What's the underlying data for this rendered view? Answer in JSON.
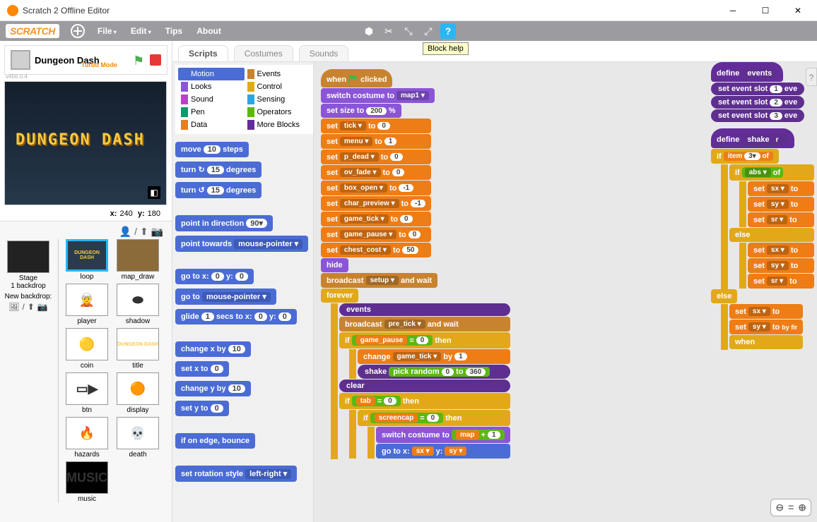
{
  "window": {
    "title": "Scratch 2 Offline Editor"
  },
  "menu": {
    "file": "File",
    "edit": "Edit",
    "tips": "Tips",
    "about": "About"
  },
  "tooltip": "Block help",
  "project": {
    "name": "Dungeon Dash",
    "turbo": "Turbo Mode",
    "version": "v456.0.4"
  },
  "stage": {
    "title_text": "DUNGEON DASH",
    "x_label": "x:",
    "x": "240",
    "y_label": "y:",
    "y": "180"
  },
  "stage_col": {
    "label": "Stage",
    "sub": "1 backdrop",
    "new": "New backdrop:"
  },
  "sprites": [
    {
      "name": "loop",
      "sel": true
    },
    {
      "name": "map_draw"
    },
    {
      "name": "player"
    },
    {
      "name": "shadow"
    },
    {
      "name": "coin"
    },
    {
      "name": "title"
    },
    {
      "name": "btn"
    },
    {
      "name": "display"
    },
    {
      "name": "hazards"
    },
    {
      "name": "death"
    },
    {
      "name": "music"
    }
  ],
  "tabs": {
    "scripts": "Scripts",
    "costumes": "Costumes",
    "sounds": "Sounds"
  },
  "categories": [
    {
      "name": "Motion",
      "color": "#4a6cd4",
      "active": true
    },
    {
      "name": "Events",
      "color": "#c88330"
    },
    {
      "name": "Looks",
      "color": "#8a55d7"
    },
    {
      "name": "Control",
      "color": "#e1a91a"
    },
    {
      "name": "Sound",
      "color": "#bb42c3"
    },
    {
      "name": "Sensing",
      "color": "#2ca5e2"
    },
    {
      "name": "Pen",
      "color": "#0e9a6c"
    },
    {
      "name": "Operators",
      "color": "#5cb712"
    },
    {
      "name": "Data",
      "color": "#ee7d16"
    },
    {
      "name": "More Blocks",
      "color": "#632d99"
    }
  ],
  "palette": {
    "move": "move",
    "move_v": "10",
    "steps": "steps",
    "turn_r": "turn ↻",
    "turn_l": "turn ↺",
    "deg_v": "15",
    "degrees": "degrees",
    "point_dir": "point in direction",
    "dir_v": "90▾",
    "point_tw": "point towards",
    "ptw_v": "mouse-pointer ▾",
    "goto": "go to x:",
    "goto_x": "0",
    "goto_yl": "y:",
    "goto_y": "0",
    "goto_mp": "go to",
    "mp_v": "mouse-pointer ▾",
    "glide": "glide",
    "glide_s": "1",
    "glide_t": "secs to x:",
    "glide_x": "0",
    "glide_y": "0",
    "chx": "change x by",
    "chx_v": "10",
    "setx": "set x to",
    "setx_v": "0",
    "chy": "change y by",
    "chy_v": "10",
    "sety": "set y to",
    "sety_v": "0",
    "edge": "if on edge, bounce",
    "rot": "set rotation style",
    "rot_v": "left-right ▾"
  },
  "script": {
    "when_clicked": "when",
    "clicked": "clicked",
    "switch_costume": "switch costume to",
    "map1": "map1 ▾",
    "set_size": "set size to",
    "size_v": "200",
    "pct": "%",
    "set": "set",
    "to": "to",
    "vars": [
      {
        "n": "tick ▾",
        "v": "0"
      },
      {
        "n": "menu ▾",
        "v": "1"
      },
      {
        "n": "p_dead ▾",
        "v": "0"
      },
      {
        "n": "ov_fade ▾",
        "v": "0"
      },
      {
        "n": "box_open ▾",
        "v": "-1"
      },
      {
        "n": "char_preview ▾",
        "v": "-1"
      },
      {
        "n": "game_tick ▾",
        "v": "0"
      },
      {
        "n": "game_pause ▾",
        "v": "0"
      },
      {
        "n": "chest_cost ▾",
        "v": "50"
      }
    ],
    "hide": "hide",
    "broadcast": "broadcast",
    "setup": "setup ▾",
    "and_wait": "and wait",
    "forever": "forever",
    "events_call": "events",
    "pre_tick": "pre_tick ▾",
    "if": "if",
    "gp_var": "game_pause",
    "eq": "=",
    "zero": "0",
    "then": "then",
    "change": "change",
    "gt_var": "game_tick ▾",
    "by": "by",
    "one": "1",
    "shake": "shake",
    "pick_random": "pick random",
    "to360": "360",
    "clear": "clear",
    "tab": "tab",
    "screencap": "screencap",
    "map": "map",
    "plus": "+",
    "gotoxy": "go to x:",
    "sx": "sx ▾",
    "sy": "sy ▾",
    "define": "define",
    "events_def": "events",
    "set_event_slot": "set event slot",
    "ev1": "1",
    "ev2": "2",
    "ev3": "3",
    "eve": "eve",
    "shake_def": "shake",
    "r_param": "r",
    "item": "item",
    "item3": "3▾",
    "of": "of",
    "abs": "abs ▾",
    "sr": "sr ▾",
    "else": "else",
    "when": "when",
    "look_by_fir": "by fir"
  },
  "zoom": {
    "in": "⊕",
    "reset": "=",
    "out": "⊖"
  },
  "help_tab": "?"
}
